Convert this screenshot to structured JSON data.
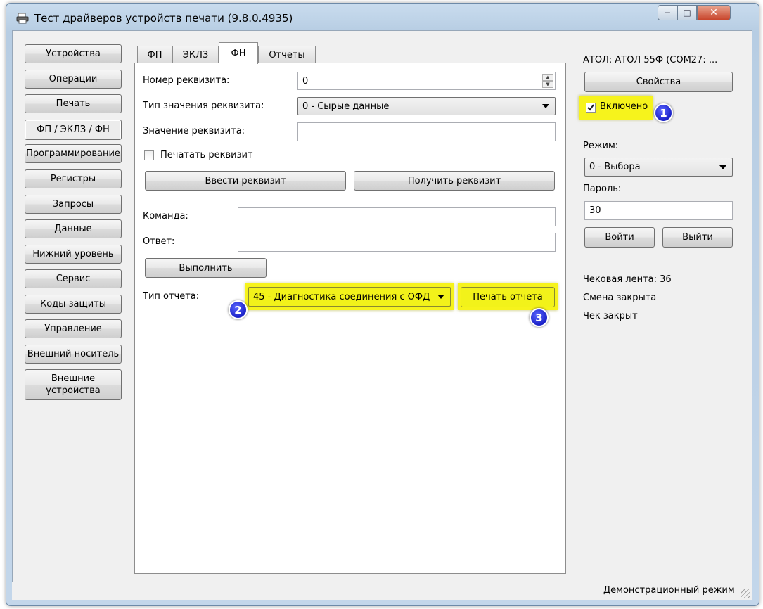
{
  "window": {
    "title": "Тест драйверов устройств печати (9.8.0.4935)",
    "controls": {
      "minimize": "−",
      "maximize": "□",
      "close": "✕"
    }
  },
  "sidebar": {
    "items": [
      {
        "label": "Устройства"
      },
      {
        "label": "Операции"
      },
      {
        "label": "Печать"
      },
      {
        "label": "ФП / ЭКЛЗ / ФН"
      },
      {
        "label": "Программирование"
      },
      {
        "label": "Регистры"
      },
      {
        "label": "Запросы"
      },
      {
        "label": "Данные"
      },
      {
        "label": "Нижний уровень"
      },
      {
        "label": "Сервис"
      },
      {
        "label": "Коды защиты"
      },
      {
        "label": "Управление"
      },
      {
        "label": "Внешний носитель"
      },
      {
        "label": "Внешние устройства"
      }
    ],
    "active_index": 3
  },
  "tabs": [
    {
      "label": "ФП"
    },
    {
      "label": "ЭКЛЗ"
    },
    {
      "label": "ФН"
    },
    {
      "label": "Отчеты"
    }
  ],
  "fn_tab": {
    "req_number_label": "Номер реквизита:",
    "req_number_value": "0",
    "req_type_label": "Тип значения реквизита:",
    "req_type_value": "0 - Сырые данные",
    "req_value_label": "Значение реквизита:",
    "req_value_value": "",
    "print_req_label": "Печатать реквизит",
    "print_req_checked": false,
    "enter_req_button": "Ввести реквизит",
    "get_req_button": "Получить реквизит",
    "command_label": "Команда:",
    "command_value": "",
    "answer_label": "Ответ:",
    "answer_value": "",
    "execute_button": "Выполнить",
    "report_type_label": "Тип отчета:",
    "report_type_value": "45 - Диагностика соединения с ОФД",
    "print_report_button": "Печать отчета"
  },
  "right_panel": {
    "device_name": "АТОЛ: АТОЛ 55Ф (COM27: ...",
    "properties_button": "Свойства",
    "enabled_label": "Включено",
    "enabled_checked": true,
    "mode_label": "Режим:",
    "mode_value": "0 - Выбора",
    "password_label": "Пароль:",
    "password_value": "30",
    "login_button": "Войти",
    "logout_button": "Выйти",
    "status_lines": [
      "Чековая лента: 36",
      "Смена закрыта",
      "Чек закрыт"
    ]
  },
  "annotations": {
    "badge1": "1",
    "badge2": "2",
    "badge3": "3"
  },
  "statusbar": {
    "text": "Демонстрационный режим"
  },
  "colors": {
    "highlight": "#f6f31c",
    "badge": "#1b22c8",
    "titlebar": "#c3d6ea"
  }
}
